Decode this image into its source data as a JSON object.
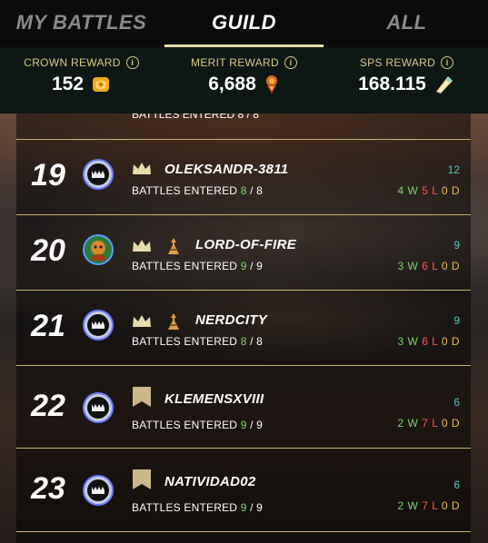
{
  "tabs": [
    {
      "label": "MY BATTLES",
      "active": false
    },
    {
      "label": "GUILD",
      "active": true
    },
    {
      "label": "ALL",
      "active": false
    }
  ],
  "rewards": {
    "crown": {
      "label": "CROWN REWARD",
      "value": "152",
      "icon": "crown-token-icon"
    },
    "merit": {
      "label": "MERIT REWARD",
      "value": "6,688",
      "icon": "merit-icon"
    },
    "sps": {
      "label": "SPS REWARD",
      "value": "168.115",
      "icon": "sps-token-icon"
    }
  },
  "partial_row": {
    "battles_label": "BATTLES ENTERED",
    "entered": "8",
    "total": "8"
  },
  "battles_label": "BATTLES ENTERED",
  "rows": [
    {
      "rank": "19",
      "name": "OLEKSANDR-3811",
      "entered": "8",
      "total": "8",
      "points": "12",
      "w": "4 W",
      "l": "5 L",
      "d": "0 D",
      "badges": [
        "crown-badge"
      ],
      "avatar": "monster-avatar"
    },
    {
      "rank": "20",
      "name": "LORD-OF-FIRE",
      "entered": "9",
      "total": "9",
      "points": "9",
      "w": "3 W",
      "l": "6 L",
      "d": "0 D",
      "badges": [
        "crown-badge",
        "tower-badge"
      ],
      "avatar": "character-avatar"
    },
    {
      "rank": "21",
      "name": "NERDCITY",
      "entered": "8",
      "total": "8",
      "points": "9",
      "w": "3 W",
      "l": "6 L",
      "d": "0 D",
      "badges": [
        "crown-badge",
        "tower-badge"
      ],
      "avatar": "monster-avatar"
    },
    {
      "rank": "22",
      "name": "KLEMENSXVIII",
      "entered": "9",
      "total": "9",
      "points": "6",
      "w": "2 W",
      "l": "7 L",
      "d": "0 D",
      "badges": [
        "banner-badge"
      ],
      "avatar": "monster-avatar"
    },
    {
      "rank": "23",
      "name": "NATIVIDAD02",
      "entered": "9",
      "total": "9",
      "points": "6",
      "w": "2 W",
      "l": "7 L",
      "d": "0 D",
      "badges": [
        "banner-badge"
      ],
      "avatar": "monster-avatar"
    }
  ],
  "colors": {
    "accent": "#e8dcaa",
    "win": "#7bd36a",
    "loss": "#ff5a5a",
    "draw": "#e7c14a",
    "points": "#59c7c0",
    "divider": "#c8b56e"
  }
}
